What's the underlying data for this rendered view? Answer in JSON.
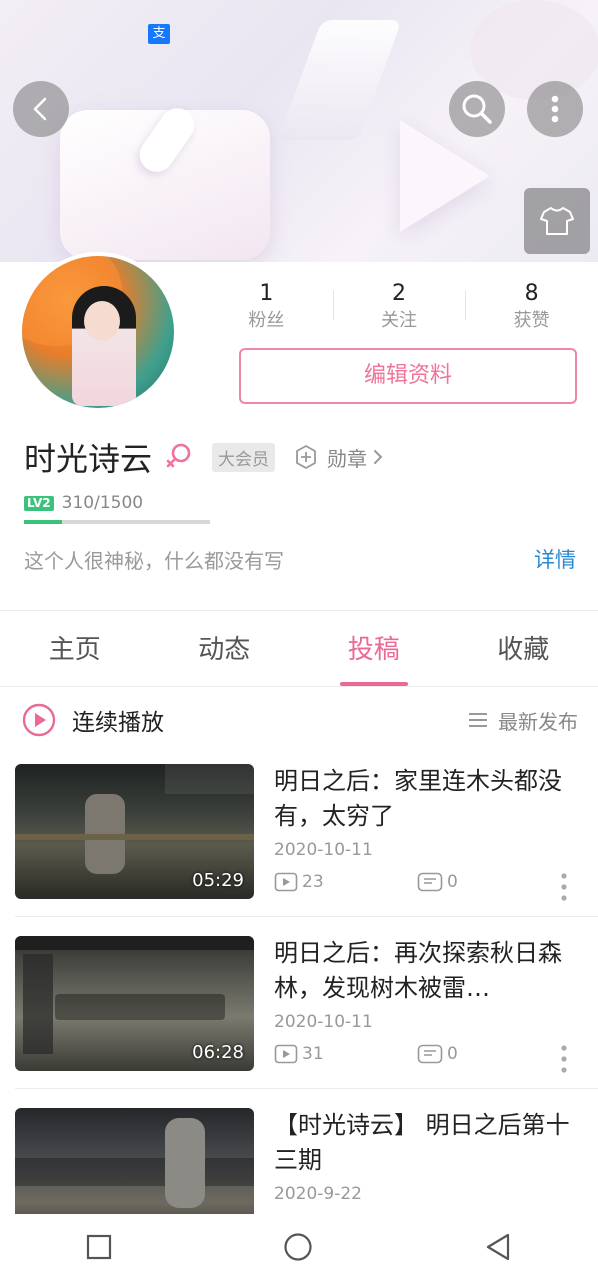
{
  "header": {
    "pay_badge": "支"
  },
  "stats": [
    {
      "count": "1",
      "label": "粉丝"
    },
    {
      "count": "2",
      "label": "关注"
    },
    {
      "count": "8",
      "label": "获赞"
    }
  ],
  "profile": {
    "edit_label": "编辑资料",
    "name": "时光诗云",
    "vip_label": "大会员",
    "medal_label": "勋章",
    "level_badge": "LV2",
    "level_exp": "310/1500",
    "level_progress": 0.2067,
    "signature": "这个人很神秘，什么都没有写",
    "detail_label": "详情"
  },
  "tabs": [
    {
      "label": "主页",
      "active": false
    },
    {
      "label": "动态",
      "active": false
    },
    {
      "label": "投稿",
      "active": true
    },
    {
      "label": "收藏",
      "active": false
    }
  ],
  "playbar": {
    "continuous_label": "连续播放",
    "sort_label": "最新发布"
  },
  "videos": [
    {
      "title": "明日之后：家里连木头都没有，太穷了",
      "date": "2020-10-11",
      "duration": "05:29",
      "plays": "23",
      "comments": "0"
    },
    {
      "title": "明日之后：再次探索秋日森林，发现树木被雷…",
      "date": "2020-10-11",
      "duration": "06:28",
      "plays": "31",
      "comments": "0"
    },
    {
      "title": "【时光诗云】 明日之后第十三期",
      "date": "2020-9-22",
      "duration": "",
      "plays": "",
      "comments": ""
    }
  ],
  "colors": {
    "accent": "#ea6a94",
    "link": "#2a8ad1",
    "level": "#38c27a"
  }
}
